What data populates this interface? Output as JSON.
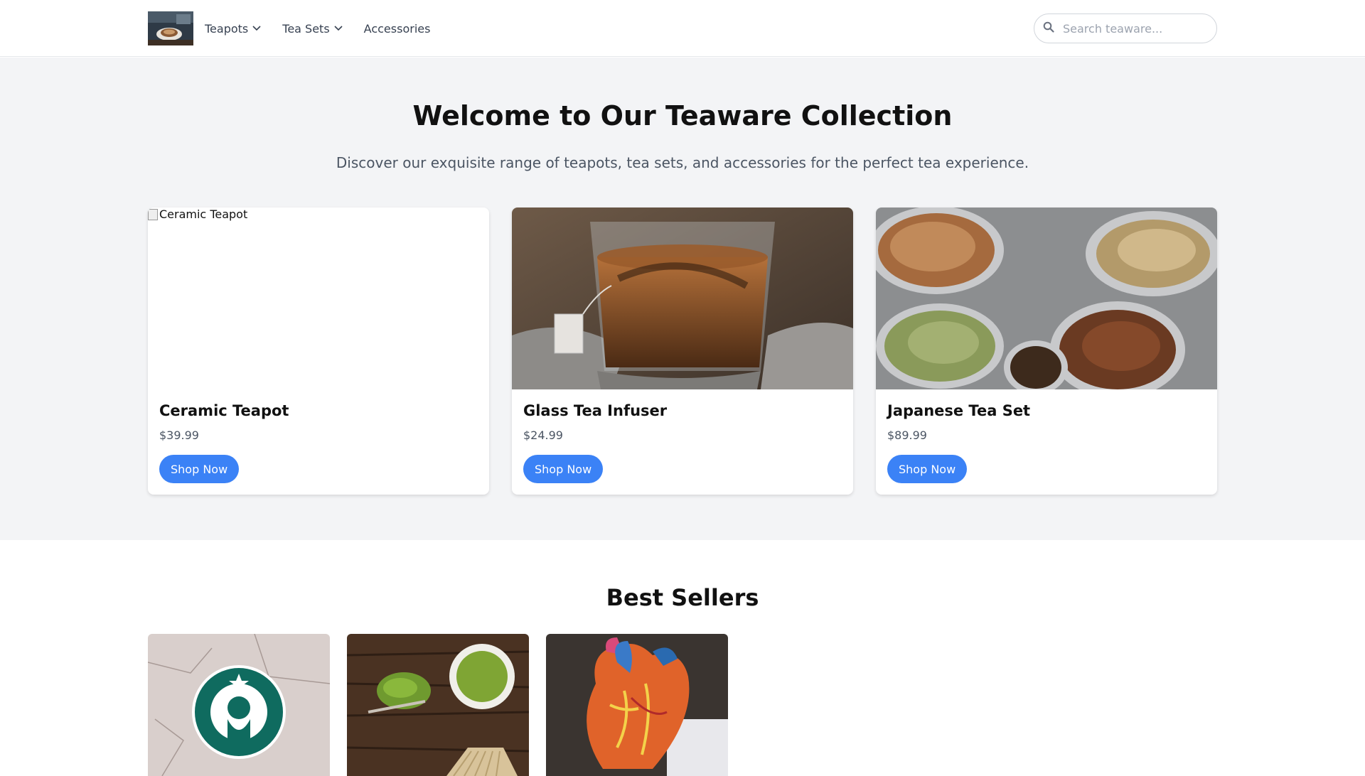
{
  "header": {
    "logo_alt": "Teaware shop logo",
    "nav": [
      {
        "label": "Teapots",
        "has_dropdown": true
      },
      {
        "label": "Tea Sets",
        "has_dropdown": true
      },
      {
        "label": "Accessories",
        "has_dropdown": false
      }
    ],
    "search": {
      "placeholder": "Search teaware...",
      "value": ""
    }
  },
  "hero": {
    "title": "Welcome to Our Teaware Collection",
    "subtitle": "Discover our exquisite range of teapots, tea sets, and accessories for the perfect tea experience."
  },
  "featured": [
    {
      "title": "Ceramic Teapot",
      "price": "$39.99",
      "button": "Shop Now",
      "image": "broken",
      "image_alt": "Ceramic Teapot"
    },
    {
      "title": "Glass Tea Infuser",
      "price": "$24.99",
      "button": "Shop Now",
      "image": "glass-tea-cup"
    },
    {
      "title": "Japanese Tea Set",
      "price": "$89.99",
      "button": "Shop Now",
      "image": "loose-leaf-tea-spoons"
    }
  ],
  "best_sellers": {
    "title": "Best Sellers",
    "items": [
      {
        "image": "siren-logo-on-stone"
      },
      {
        "image": "matcha-bowl-and-whisk"
      },
      {
        "image": "anatomical-heart-model"
      }
    ]
  },
  "colors": {
    "accent": "#3b82f6",
    "hero_bg": "#f3f4f6",
    "text_dark": "#111111",
    "text_muted": "#4b5563"
  }
}
